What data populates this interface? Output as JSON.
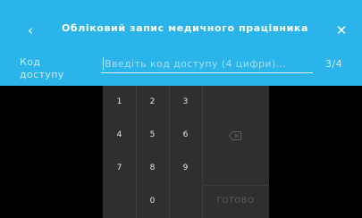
{
  "header": {
    "title": "Обліковий запис медичного працівника",
    "back_icon": "‹",
    "close_icon": "✕"
  },
  "access_code": {
    "label": "Код доступу",
    "value": "",
    "placeholder": "Введіть код доступу (4 цифри)...",
    "step_counter": "3/4"
  },
  "keypad": {
    "keys": [
      "1",
      "2",
      "3",
      "4",
      "5",
      "6",
      "7",
      "8",
      "9",
      "0"
    ],
    "backspace_icon": "backspace-icon",
    "done_label": "ГОТОВО"
  },
  "colors": {
    "header_bg": "#2ab4ea",
    "keypad_bg": "#2f2f2f",
    "screen_bg": "#000000"
  }
}
